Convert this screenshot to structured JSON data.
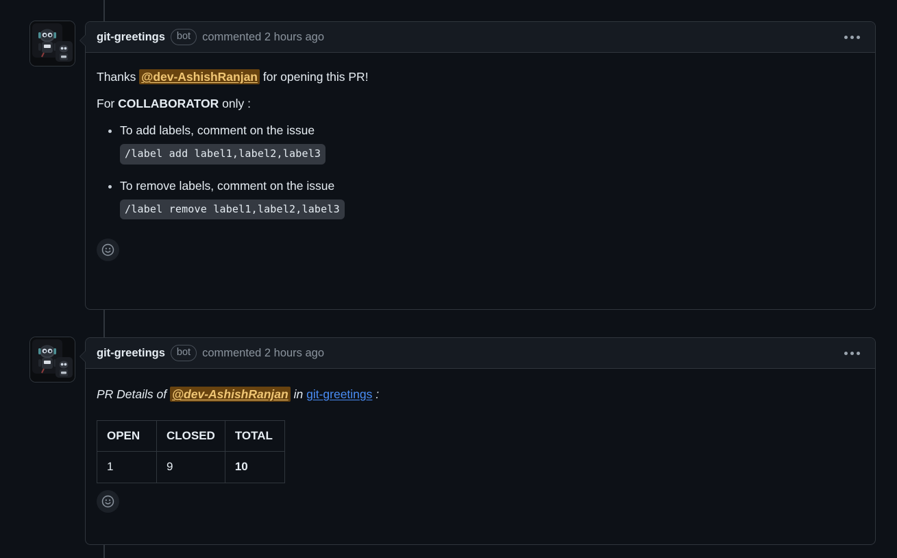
{
  "theme": {
    "page_bg": "#0d1117",
    "box_bg": "#0d1117",
    "header_bg": "#161b22",
    "border": "#30363d",
    "text": "#e6edf3",
    "muted_text": "#8b949e",
    "mention_bg": "#68430f",
    "mention_fg": "#f0c674",
    "link": "#4a8ef7",
    "code_bg": "#343941"
  },
  "comments": [
    {
      "author": "git-greetings",
      "badge": "bot",
      "meta": "commented 2 hours ago",
      "avatar_alt": "robot-avatar",
      "menu_icon": "kebab-menu-icon",
      "reaction_icon": "smiley-reaction-icon",
      "body": {
        "thanks_prefix": "Thanks ",
        "mention": "@dev-AshishRanjan",
        "thanks_suffix": " for opening this PR!",
        "for_prefix": "For ",
        "for_strong": "COLLABORATOR",
        "for_suffix": " only :",
        "items": [
          {
            "text": "To add labels, comment on the issue",
            "code": "/label add label1,label2,label3"
          },
          {
            "text": "To remove labels, comment on the issue",
            "code": "/label remove label1,label2,label3"
          }
        ]
      }
    },
    {
      "author": "git-greetings",
      "badge": "bot",
      "meta": "commented 2 hours ago",
      "avatar_alt": "robot-avatar",
      "menu_icon": "kebab-menu-icon",
      "reaction_icon": "smiley-reaction-icon",
      "pr_details": {
        "prefix": "PR Details of ",
        "mention": "@dev-AshishRanjan",
        "middle": " in ",
        "repo_link": "git-greetings",
        "suffix": " :"
      },
      "table": {
        "headers": [
          "OPEN",
          "CLOSED",
          "TOTAL"
        ],
        "rows": [
          [
            "1",
            "9",
            "10"
          ]
        ]
      }
    }
  ]
}
